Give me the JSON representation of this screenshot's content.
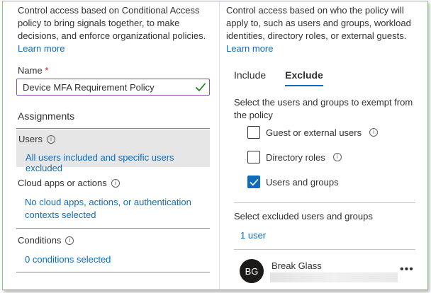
{
  "left": {
    "intro_line1": "Control access based on Conditional Access",
    "intro_line2": "policy to bring signals together, to make",
    "intro_line3": "decisions, and enforce organizational policies.",
    "learn_more": "Learn more",
    "name_label": "Name",
    "name_required": "*",
    "name_value": "Device MFA Requirement Policy",
    "assignments_heading": "Assignments",
    "users_title": "Users",
    "users_value": "All users included and specific users excluded",
    "cloud_title": "Cloud apps or actions",
    "cloud_value_line1": "No cloud apps, actions, or authentication",
    "cloud_value_line2": "contexts selected",
    "conditions_title": "Conditions",
    "conditions_value": "0 conditions selected"
  },
  "right": {
    "intro_line1": "Control access based on who the policy will",
    "intro_line2": "apply to, such as users and groups, workload",
    "intro_line3": "identities, directory roles, or external guests.",
    "learn_more": "Learn more",
    "tabs": [
      {
        "label": "Include",
        "active": false
      },
      {
        "label": "Exclude",
        "active": true
      }
    ],
    "exempt_line1": "Select the users and groups to exempt from",
    "exempt_line2": "the policy",
    "options": [
      {
        "label": "Guest or external users",
        "checked": false,
        "info": true
      },
      {
        "label": "Directory roles",
        "checked": false,
        "info": true
      },
      {
        "label": "Users and groups",
        "checked": true,
        "info": false
      }
    ],
    "excluded_heading": "Select excluded users and groups",
    "excluded_count": "1 user",
    "person": {
      "initials": "BG",
      "name": "Break Glass"
    }
  },
  "icons": {
    "info": "info-icon",
    "check": "checkmark-icon",
    "more": "more-ellipsis-icon"
  },
  "colors": {
    "link": "#0f6cbd",
    "input_border": "#8a4fae",
    "selected_bg": "#e6e6e6",
    "success": "#107c10"
  }
}
